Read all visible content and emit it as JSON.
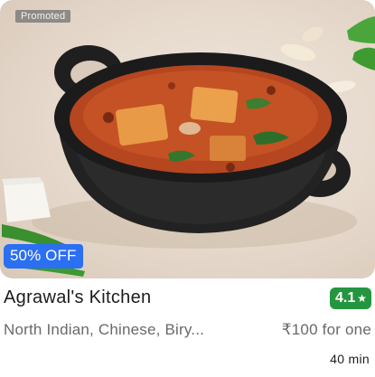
{
  "card": {
    "promoted_label": "Promoted",
    "offer_label": "50% OFF",
    "restaurant_name": "Agrawal's Kitchen",
    "rating": "4.1",
    "rating_icon": "star-icon",
    "cuisines": "North Indian, Chinese, Biry...",
    "price": "₹100 for one",
    "delivery_time": "40 min"
  },
  "colors": {
    "rating_badge": "#24963f",
    "offer_badge": "#2b6ff3",
    "secondary_text": "#696969"
  }
}
